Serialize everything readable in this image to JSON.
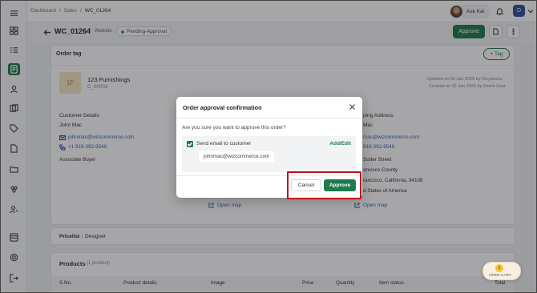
{
  "breadcrumbs": [
    "Dashboard",
    "/",
    "Sales",
    "/",
    "WC_01264"
  ],
  "user": {
    "name": "Ask Kai",
    "initial": "D"
  },
  "header": {
    "order_id": "WC_01264",
    "channel": "Website",
    "status": "Pending-Approval",
    "approve_label": "Approve"
  },
  "order_tag": {
    "title": "Order tag",
    "add_label": "+ Tag"
  },
  "customer_card": {
    "initials": "1F",
    "company": "123 Furnishings",
    "code": "C_00003",
    "updated": "Updated on 02 Jan 2026 by Divyanshu",
    "created": "Created on 02 Jan 2026 by Demo User"
  },
  "customer_details": {
    "title": "Customer Details",
    "name": "John Mac",
    "email": "johnmac@wizcommerce.com",
    "phone": "+1 918-392-9549",
    "role": "Associate Buyer"
  },
  "shipping": {
    "title_fragment": "ping Address",
    "name_fragment": "Mac",
    "email_fragment": "mac@wizcommerce.com",
    "phone_fragment": "918-392-9549",
    "line1": "Sutter Street",
    "line2": "ancisco County",
    "line3": "rancisco, California, 94108",
    "line4": "d States of America"
  },
  "open_map": "Open map",
  "pricelist": {
    "label": "Pricelist :",
    "value": "Designer"
  },
  "products": {
    "title": "Products",
    "count": "(1 product)",
    "columns": [
      "S.No.",
      "Product details",
      "Image",
      "Price",
      "Quantity",
      "Item status",
      "Total"
    ]
  },
  "modal": {
    "title": "Order approval confirmation",
    "question": "Are you sure you want to approve this order?",
    "send_email_label": "Send email to customer",
    "add_edit": "Add/Edit",
    "email_chip": "johnmac@wizcommerce.com",
    "cancel": "Cancel",
    "approve": "Approve"
  },
  "cart": {
    "count": "1",
    "label": "OPEN CART"
  },
  "colors": {
    "accent": "#1f7a4d",
    "highlight": "#c0101a",
    "link": "#3b63b8"
  }
}
